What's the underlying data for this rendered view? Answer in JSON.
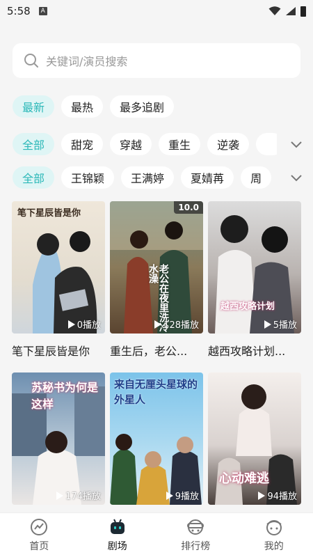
{
  "status_bar": {
    "time": "5:58",
    "notification_letter": "A"
  },
  "search": {
    "placeholder": "关键词/演员搜索"
  },
  "sort_tabs": [
    "最新",
    "最热",
    "最多追剧"
  ],
  "genre_tabs": [
    "全部",
    "甜宠",
    "穿越",
    "重生",
    "逆袭"
  ],
  "actor_tabs": [
    "全部",
    "王锦颖",
    "王满婷",
    "夏婧苒",
    "周"
  ],
  "dramas": [
    {
      "title": "笔下星辰皆是你",
      "plays": "0播放",
      "poster_text": "笔下星辰皆是你",
      "score": ""
    },
    {
      "title": "重生后，老公...",
      "plays": "128播放",
      "poster_text": "老公在夜里洗冷水澡",
      "score": "10.0"
    },
    {
      "title": "越西攻略计划...",
      "plays": "5播放",
      "poster_text": "越西攻略计划",
      "score": ""
    },
    {
      "title": "",
      "plays": "174播放",
      "poster_text": "苏秘书为何是这样",
      "score": ""
    },
    {
      "title": "",
      "plays": "9播放",
      "poster_text": "来自无厘头星球的外星人",
      "score": ""
    },
    {
      "title": "",
      "plays": "94播放",
      "poster_text": "心动难逃",
      "score": ""
    }
  ],
  "tabbar": [
    {
      "label": "首页",
      "icon": "home-icon"
    },
    {
      "label": "剧场",
      "icon": "theater-icon"
    },
    {
      "label": "排行榜",
      "icon": "ranking-icon"
    },
    {
      "label": "我的",
      "icon": "profile-icon"
    }
  ],
  "colors": {
    "accent": "#2bb8b8",
    "accent_bg": "#dff5f5",
    "page_bg": "#f5f5f5"
  }
}
